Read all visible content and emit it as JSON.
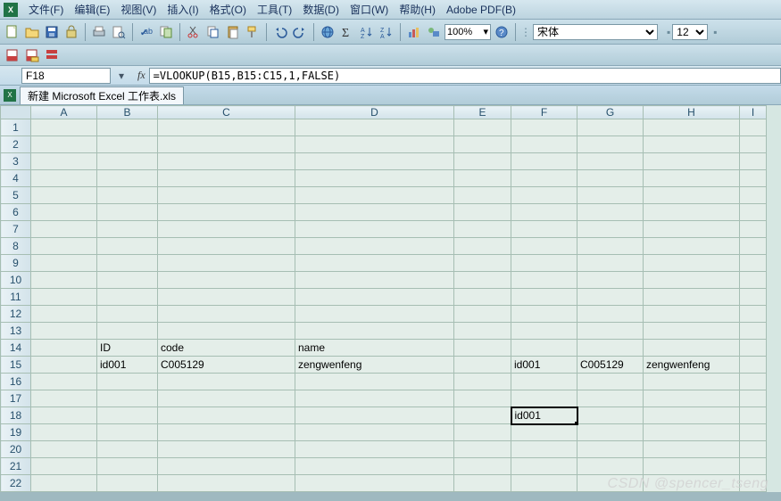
{
  "menubar": {
    "items": [
      {
        "label": "文件(F)",
        "key": "F"
      },
      {
        "label": "编辑(E)",
        "key": "E"
      },
      {
        "label": "视图(V)",
        "key": "V"
      },
      {
        "label": "插入(I)",
        "key": "I"
      },
      {
        "label": "格式(O)",
        "key": "O"
      },
      {
        "label": "工具(T)",
        "key": "T"
      },
      {
        "label": "数据(D)",
        "key": "D"
      },
      {
        "label": "窗口(W)",
        "key": "W"
      },
      {
        "label": "帮助(H)",
        "key": "H"
      },
      {
        "label": "Adobe PDF(B)",
        "key": "B"
      }
    ]
  },
  "toolbar": {
    "zoom": "100%",
    "font_name": "宋体",
    "font_size": "12"
  },
  "formula_bar": {
    "cell_ref": "F18",
    "formula": "=VLOOKUP(B15,B15:C15,1,FALSE)"
  },
  "doc_tab": {
    "label": "新建 Microsoft Excel 工作表.xls"
  },
  "columns": [
    "A",
    "B",
    "C",
    "D",
    "E",
    "F",
    "G",
    "H",
    "I"
  ],
  "rows": 22,
  "cells": {
    "B14": "ID",
    "C14": "code",
    "D14": "name",
    "B15": "id001",
    "C15": "C005129",
    "D15": "zengwenfeng",
    "F15": "id001",
    "G15": "C005129",
    "H15": "zengwenfeng",
    "F18": "id001"
  },
  "active_cell": "F18",
  "watermark": "CSDN @spencer_tseng"
}
